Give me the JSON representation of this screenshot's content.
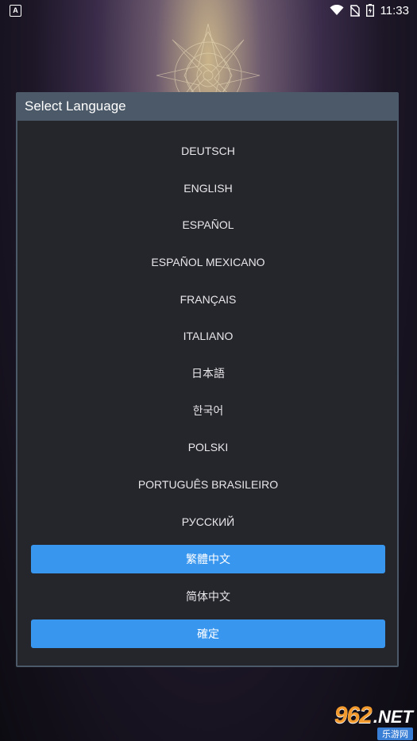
{
  "status_bar": {
    "notification_icon": "A",
    "time": "11:33",
    "icons": [
      "wifi-icon",
      "no-sim-icon",
      "battery-icon"
    ]
  },
  "dialog": {
    "title": "Select Language",
    "languages": [
      {
        "label": "DEUTSCH",
        "selected": false
      },
      {
        "label": "ENGLISH",
        "selected": false
      },
      {
        "label": "ESPAÑOL",
        "selected": false
      },
      {
        "label": "ESPAÑOL MEXICANO",
        "selected": false
      },
      {
        "label": "FRANÇAIS",
        "selected": false
      },
      {
        "label": "ITALIANO",
        "selected": false
      },
      {
        "label": "日本語",
        "selected": false
      },
      {
        "label": "한국어",
        "selected": false
      },
      {
        "label": "POLSKI",
        "selected": false
      },
      {
        "label": "PORTUGUÊS BRASILEIRO",
        "selected": false
      },
      {
        "label": "РУССКИЙ",
        "selected": false
      },
      {
        "label": "繁體中文",
        "selected": true
      },
      {
        "label": "简体中文",
        "selected": false
      }
    ],
    "confirm_label": "確定"
  },
  "watermark": {
    "number": "962",
    "suffix": ".NET",
    "subtitle": "乐游网"
  },
  "colors": {
    "accent": "#3996ee",
    "dialog_frame": "#4b5968",
    "dialog_body": "#25252c"
  }
}
